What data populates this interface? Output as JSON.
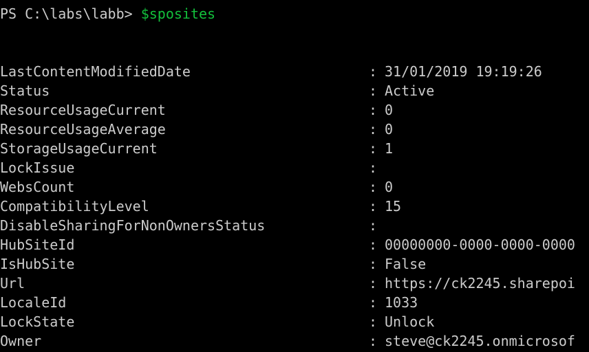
{
  "console": {
    "prompt": "PS C:\\labs\\labb> ",
    "command": "$sposites",
    "separator": ":",
    "colors": {
      "background": "#000000",
      "text": "#cccccc",
      "command": "#13c13c"
    },
    "rows": [
      {
        "name": "LastContentModifiedDate",
        "value": "31/01/2019 19:19:26"
      },
      {
        "name": "Status",
        "value": "Active"
      },
      {
        "name": "ResourceUsageCurrent",
        "value": "0"
      },
      {
        "name": "ResourceUsageAverage",
        "value": "0"
      },
      {
        "name": "StorageUsageCurrent",
        "value": "1"
      },
      {
        "name": "LockIssue",
        "value": ""
      },
      {
        "name": "WebsCount",
        "value": "0"
      },
      {
        "name": "CompatibilityLevel",
        "value": "15"
      },
      {
        "name": "DisableSharingForNonOwnersStatus",
        "value": ""
      },
      {
        "name": "HubSiteId",
        "value": "00000000-0000-0000-0000"
      },
      {
        "name": "IsHubSite",
        "value": "False"
      },
      {
        "name": "Url",
        "value": "https://ck2245.sharepoi"
      },
      {
        "name": "LocaleId",
        "value": "1033"
      },
      {
        "name": "LockState",
        "value": "Unlock"
      },
      {
        "name": "Owner",
        "value": "steve@ck2245.onmicrosof"
      }
    ]
  }
}
